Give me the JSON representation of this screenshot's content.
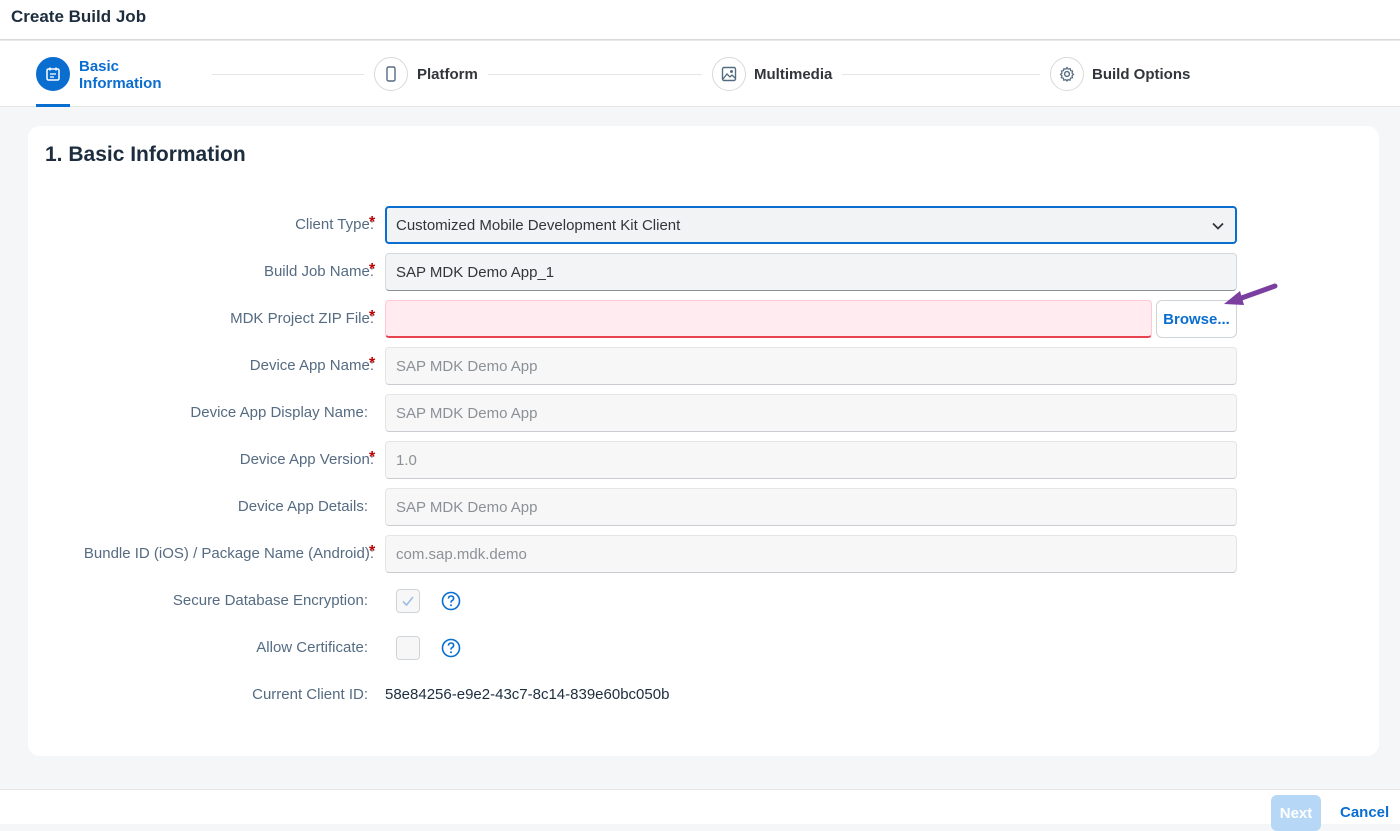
{
  "window": {
    "title": "Create Build Job"
  },
  "wizard": {
    "steps": [
      {
        "label_line1": "Basic",
        "label_line2": "Information",
        "icon": "calendar-icon",
        "active": true
      },
      {
        "label": "Platform",
        "icon": "phone-icon"
      },
      {
        "label": "Multimedia",
        "icon": "image-icon"
      },
      {
        "label": "Build Options",
        "icon": "gear-icon"
      }
    ]
  },
  "section": {
    "title": "1. Basic Information"
  },
  "form": {
    "client_type": {
      "label": "Client Type:",
      "value": "Customized Mobile Development Kit Client",
      "required": "*"
    },
    "build_job_name": {
      "label": "Build Job Name:",
      "value": "SAP MDK Demo App_1",
      "required": "*"
    },
    "mdk_zip": {
      "label": "MDK Project ZIP File:",
      "value": "",
      "required": "*",
      "browse_label": "Browse..."
    },
    "device_app_name": {
      "label": "Device App Name:",
      "placeholder": "SAP MDK Demo App",
      "required": "*"
    },
    "device_app_display_name": {
      "label": "Device App Display Name:",
      "placeholder": "SAP MDK Demo App"
    },
    "device_app_version": {
      "label": "Device App Version:",
      "placeholder": "1.0",
      "required": "*"
    },
    "device_app_details": {
      "label": "Device App Details:",
      "placeholder": "SAP MDK Demo App"
    },
    "bundle_id": {
      "label": "Bundle ID (iOS) / Package Name (Android):",
      "placeholder": "com.sap.mdk.demo",
      "required": "*"
    },
    "secure_db": {
      "label": "Secure Database Encryption:",
      "checked": true
    },
    "allow_cert": {
      "label": "Allow Certificate:",
      "checked": false
    },
    "client_id": {
      "label": "Current Client ID:",
      "value": "58e84256-e9e2-43c7-8c14-839e60bc050b"
    }
  },
  "footer": {
    "next_label": "Next",
    "cancel_label": "Cancel"
  },
  "colors": {
    "accent": "#0a6ed1",
    "error": "#e9434f",
    "annotation_arrow": "#7b3fa0"
  }
}
